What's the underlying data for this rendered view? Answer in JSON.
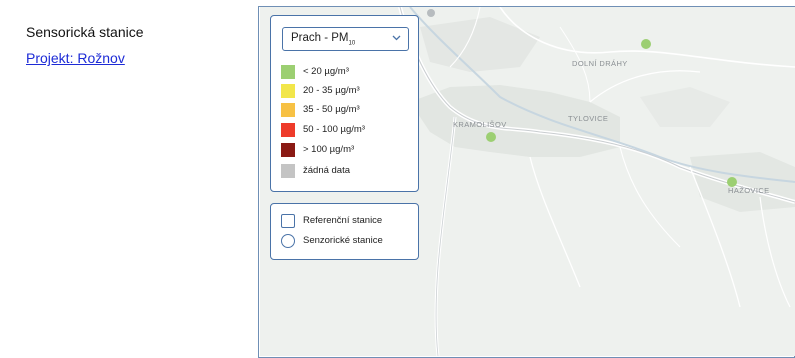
{
  "sidebar": {
    "title": "Sensorická stanice",
    "project_link": "Projekt: Rožnov"
  },
  "pollutant_select": {
    "label": "Prach - PM",
    "subscript": "10"
  },
  "legend": [
    {
      "label": "< 20 µg/m³",
      "color": "#9ccf72"
    },
    {
      "label": "20 - 35 µg/m³",
      "color": "#f2e64a"
    },
    {
      "label": "35 - 50 µg/m³",
      "color": "#f7c144"
    },
    {
      "label": "50 - 100 µg/m³",
      "color": "#ee3b2a"
    },
    {
      "label": "> 100 µg/m³",
      "color": "#8a1a14"
    },
    {
      "label": "žádná data",
      "color": "#c4c4c4"
    }
  ],
  "layers": {
    "reference": "Referenční stanice",
    "sensor": "Senzorické stanice"
  },
  "places": [
    "DOLNÍ DRÁHY",
    "KRAMOLIŠOV",
    "TYLOVICE",
    "HAŽOVICE"
  ],
  "colors": {
    "accent": "#4a73a8",
    "link": "#1d2bd6",
    "station": "#9ccf72"
  }
}
